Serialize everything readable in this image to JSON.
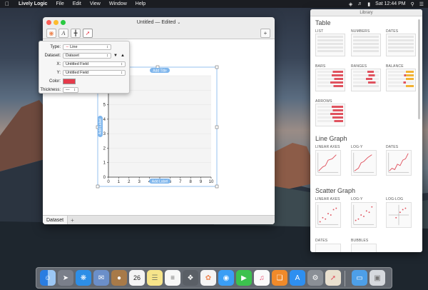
{
  "menubar": {
    "app_name": "Lively Logic",
    "items": [
      "File",
      "Edit",
      "View",
      "Window",
      "Help"
    ],
    "clock": "Sat 12:44 PM"
  },
  "window": {
    "title": "Untitled — Edited",
    "tab_label": "Dataset"
  },
  "inspector": {
    "type_label": "Type:",
    "type_value": "Line",
    "dataset_label": "Dataset:",
    "dataset_value": "Dataset",
    "x_label": "X:",
    "x_value": "Untitled Field",
    "y_label": "Y:",
    "y_value": "Untitled Field",
    "color_label": "Color:",
    "color_value": "#e53b4b",
    "thickness_label": "Thickness:"
  },
  "chart_data": {
    "type": "line",
    "title": "Add Title",
    "xlabel": "Add Label",
    "ylabel": "Add Label",
    "x_ticks": [
      "0",
      "1",
      "2",
      "3",
      "4",
      "5",
      "6",
      "7",
      "8",
      "9",
      "10"
    ],
    "y_ticks": [
      "0",
      "1",
      "2",
      "3",
      "4",
      "5",
      "6",
      "7"
    ],
    "xlim": [
      0,
      10
    ],
    "ylim": [
      0,
      7
    ],
    "series": []
  },
  "library": {
    "title": "Library",
    "sections": {
      "table": "Table",
      "line_graph": "Line Graph",
      "scatter_graph": "Scatter Graph"
    },
    "table_items": [
      "LIST",
      "NUMBERS",
      "DATES",
      "BARS",
      "RANGES",
      "BALANCE",
      "ARROWS"
    ],
    "line_items": [
      "LINEAR AXES",
      "LOG-Y",
      "DATES"
    ],
    "scatter_items": [
      "LINEAR AXES",
      "LOG-Y",
      "LOG-LOG",
      "DATES",
      "BUBBLES"
    ]
  },
  "dock": {
    "calendar_day": "26",
    "accent": "#2a7de1"
  }
}
